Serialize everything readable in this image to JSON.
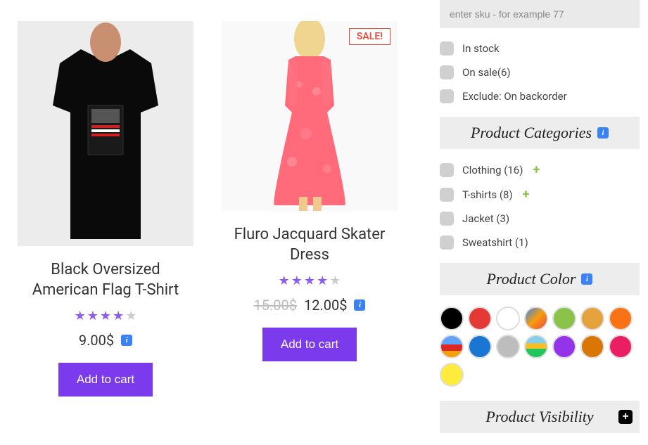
{
  "products": [
    {
      "title": "Black Oversized American Flag T-Shirt",
      "rating": 4,
      "price": "9.00$",
      "old_price": "",
      "sale": false,
      "cta": "Add to cart"
    },
    {
      "title": "Fluro Jacquard Skater Dress",
      "rating": 4,
      "price": "12.00$",
      "old_price": "15.00$",
      "sale": true,
      "sale_label": "SALE!",
      "cta": "Add to cart"
    }
  ],
  "sidebar": {
    "search_placeholder": "enter sku - for example 77",
    "stock_filters": [
      {
        "label": "In stock"
      },
      {
        "label": "On sale(6)"
      },
      {
        "label": "Exclude: On backorder"
      }
    ],
    "sections": {
      "categories": {
        "title": "Product Categories",
        "items": [
          {
            "label": "Clothing (16)",
            "expandable": true
          },
          {
            "label": "T-shirts (8)",
            "expandable": true
          },
          {
            "label": "Jacket (3)",
            "expandable": false
          },
          {
            "label": "Sweatshirt (1)",
            "expandable": false
          }
        ]
      },
      "color": {
        "title": "Product Color"
      },
      "visibility": {
        "title": "Product Visibility"
      }
    },
    "colors": [
      "black",
      "red",
      "white",
      "img1",
      "lime",
      "orange1",
      "orange2",
      "img2",
      "blue",
      "gray",
      "img3",
      "purple",
      "orange3",
      "magenta",
      "yellow"
    ]
  }
}
